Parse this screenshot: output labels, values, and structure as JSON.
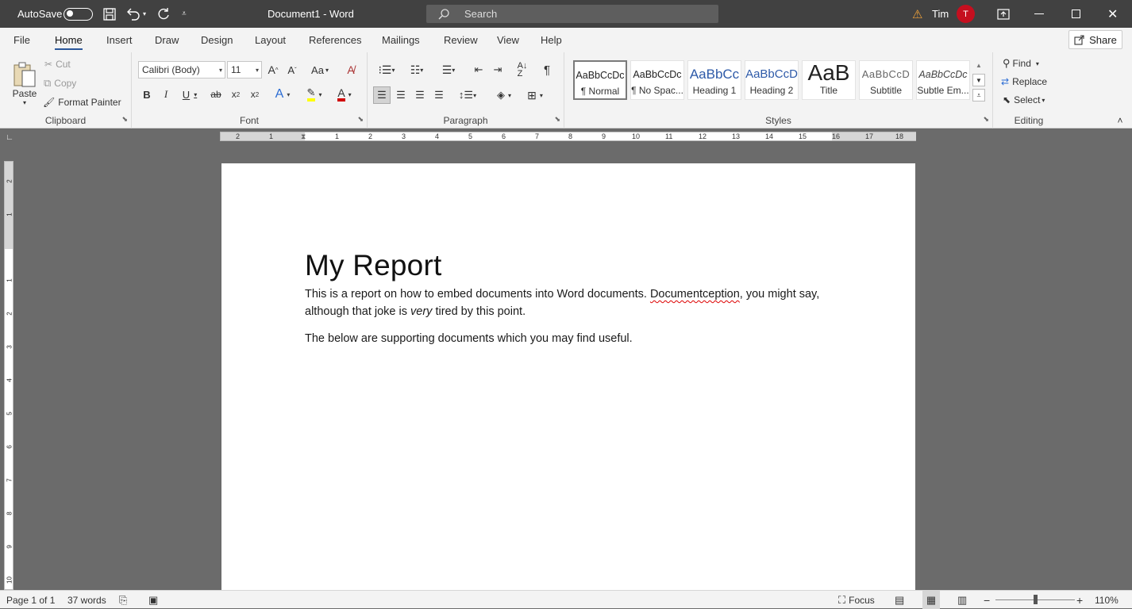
{
  "titlebar": {
    "autosave_label": "AutoSave",
    "doc_title": "Document1  -  Word",
    "search_placeholder": "Search",
    "user_name": "Tim",
    "user_initial": "T"
  },
  "tabs": [
    "File",
    "Home",
    "Insert",
    "Draw",
    "Design",
    "Layout",
    "References",
    "Mailings",
    "Review",
    "View",
    "Help"
  ],
  "share_label": "Share",
  "clipboard": {
    "paste": "Paste",
    "cut": "Cut",
    "copy": "Copy",
    "format_painter": "Format Painter",
    "group": "Clipboard"
  },
  "font": {
    "family": "Calibri (Body)",
    "size": "11",
    "group": "Font"
  },
  "paragraph": {
    "group": "Paragraph"
  },
  "styles": {
    "group": "Styles",
    "items": [
      {
        "preview": "AaBbCcDc",
        "name": "¶ Normal"
      },
      {
        "preview": "AaBbCcDc",
        "name": "¶ No Spac..."
      },
      {
        "preview": "AaBbCc",
        "name": "Heading 1"
      },
      {
        "preview": "AaBbCcD",
        "name": "Heading 2"
      },
      {
        "preview": "AaB",
        "name": "Title"
      },
      {
        "preview": "AaBbCcD",
        "name": "Subtitle"
      },
      {
        "preview": "AaBbCcDc",
        "name": "Subtle Em..."
      }
    ]
  },
  "editing": {
    "find": "Find",
    "replace": "Replace",
    "select": "Select",
    "group": "Editing"
  },
  "ruler_h": [
    "2",
    "1",
    "1",
    "2",
    "3",
    "4",
    "5",
    "6",
    "7",
    "8",
    "9",
    "10",
    "11",
    "12",
    "13",
    "14",
    "15",
    "16",
    "17",
    "18"
  ],
  "ruler_v": [
    "2",
    "1",
    "1",
    "2",
    "3",
    "4",
    "5",
    "6",
    "7",
    "8",
    "9",
    "10"
  ],
  "document": {
    "title": "My Report",
    "p1_a": "This is a report on how to embed documents into Word documents. ",
    "p1_misspelled": "Documentception",
    "p1_b": ", you might say, although that joke is ",
    "p1_italic": "very",
    "p1_c": " tired by this point.",
    "p2": "The below are supporting documents which you may find useful."
  },
  "status": {
    "page": "Page 1 of 1",
    "words": "37 words",
    "focus": "Focus",
    "zoom": "110%"
  },
  "colors": {
    "accent": "#2b579a",
    "titlebar": "#414141",
    "avatar": "#c50f1f",
    "highlight": "#ffff00",
    "font_color": "#d00000"
  }
}
